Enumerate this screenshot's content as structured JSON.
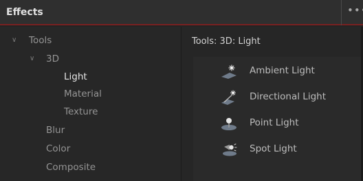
{
  "panel": {
    "title": "Effects",
    "more_label": "•••"
  },
  "tree": {
    "items": [
      {
        "label": "Tools",
        "expanded": true
      },
      {
        "label": "3D",
        "expanded": true
      },
      {
        "label": "Light",
        "selected": true
      },
      {
        "label": "Material"
      },
      {
        "label": "Texture"
      },
      {
        "label": "Blur"
      },
      {
        "label": "Color"
      },
      {
        "label": "Composite"
      }
    ],
    "chevron": "∨"
  },
  "content": {
    "breadcrumb": "Tools: 3D: Light",
    "effects": [
      {
        "label": "Ambient Light",
        "icon": "ambient-light-icon"
      },
      {
        "label": "Directional Light",
        "icon": "directional-light-icon"
      },
      {
        "label": "Point Light",
        "icon": "point-light-icon"
      },
      {
        "label": "Spot Light",
        "icon": "spot-light-icon"
      }
    ]
  },
  "colors": {
    "accent": "#7a2020",
    "background": "#232323",
    "text": "#9c9c9c",
    "selected_text": "#e6e6e6"
  }
}
